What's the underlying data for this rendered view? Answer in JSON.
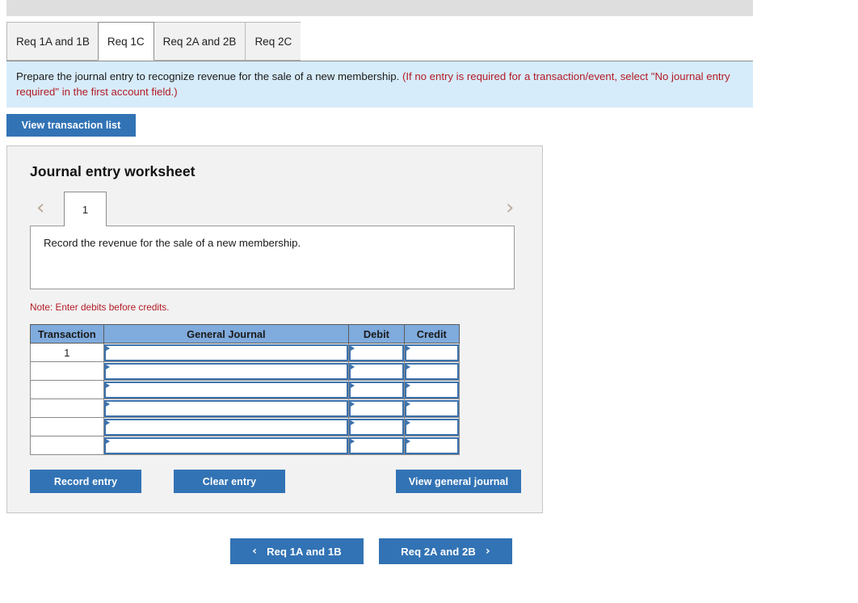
{
  "tabs": [
    {
      "label": "Req 1A and 1B",
      "active": false
    },
    {
      "label": "Req 1C",
      "active": true
    },
    {
      "label": "Req 2A and 2B",
      "active": false
    },
    {
      "label": "Req 2C",
      "active": false
    }
  ],
  "instruction": {
    "main": "Prepare the journal entry to recognize revenue for the sale of a new membership.",
    "hint": "(If no entry is required for a transaction/event, select \"No journal entry required\" in the first account field.)"
  },
  "toolbar": {
    "view_transaction_list": "View transaction list"
  },
  "worksheet": {
    "title": "Journal entry worksheet",
    "prev_arrow": "‹",
    "next_arrow": "›",
    "page_tab": "1",
    "description": "Record the revenue for the sale of a new membership.",
    "note": "Note: Enter debits before credits.",
    "table": {
      "headers": [
        "Transaction",
        "General Journal",
        "Debit",
        "Credit"
      ],
      "rows": [
        {
          "transaction": "1",
          "general_journal": "",
          "debit": "",
          "credit": ""
        },
        {
          "transaction": "",
          "general_journal": "",
          "debit": "",
          "credit": ""
        },
        {
          "transaction": "",
          "general_journal": "",
          "debit": "",
          "credit": ""
        },
        {
          "transaction": "",
          "general_journal": "",
          "debit": "",
          "credit": ""
        },
        {
          "transaction": "",
          "general_journal": "",
          "debit": "",
          "credit": ""
        },
        {
          "transaction": "",
          "general_journal": "",
          "debit": "",
          "credit": ""
        }
      ]
    },
    "actions": {
      "record_entry": "Record entry",
      "clear_entry": "Clear entry",
      "view_general_journal": "View general journal"
    }
  },
  "footer_nav": {
    "prev_label": "Req 1A and 1B",
    "prev_arrow": "‹",
    "next_label": "Req 2A and 2B",
    "next_arrow": "›"
  },
  "colors": {
    "accent_blue": "#3273b5",
    "table_header_blue": "#7fabdd",
    "banner_blue": "#d7ecfa",
    "hint_red": "#b31b26",
    "panel_gray": "#f2f2f2"
  }
}
